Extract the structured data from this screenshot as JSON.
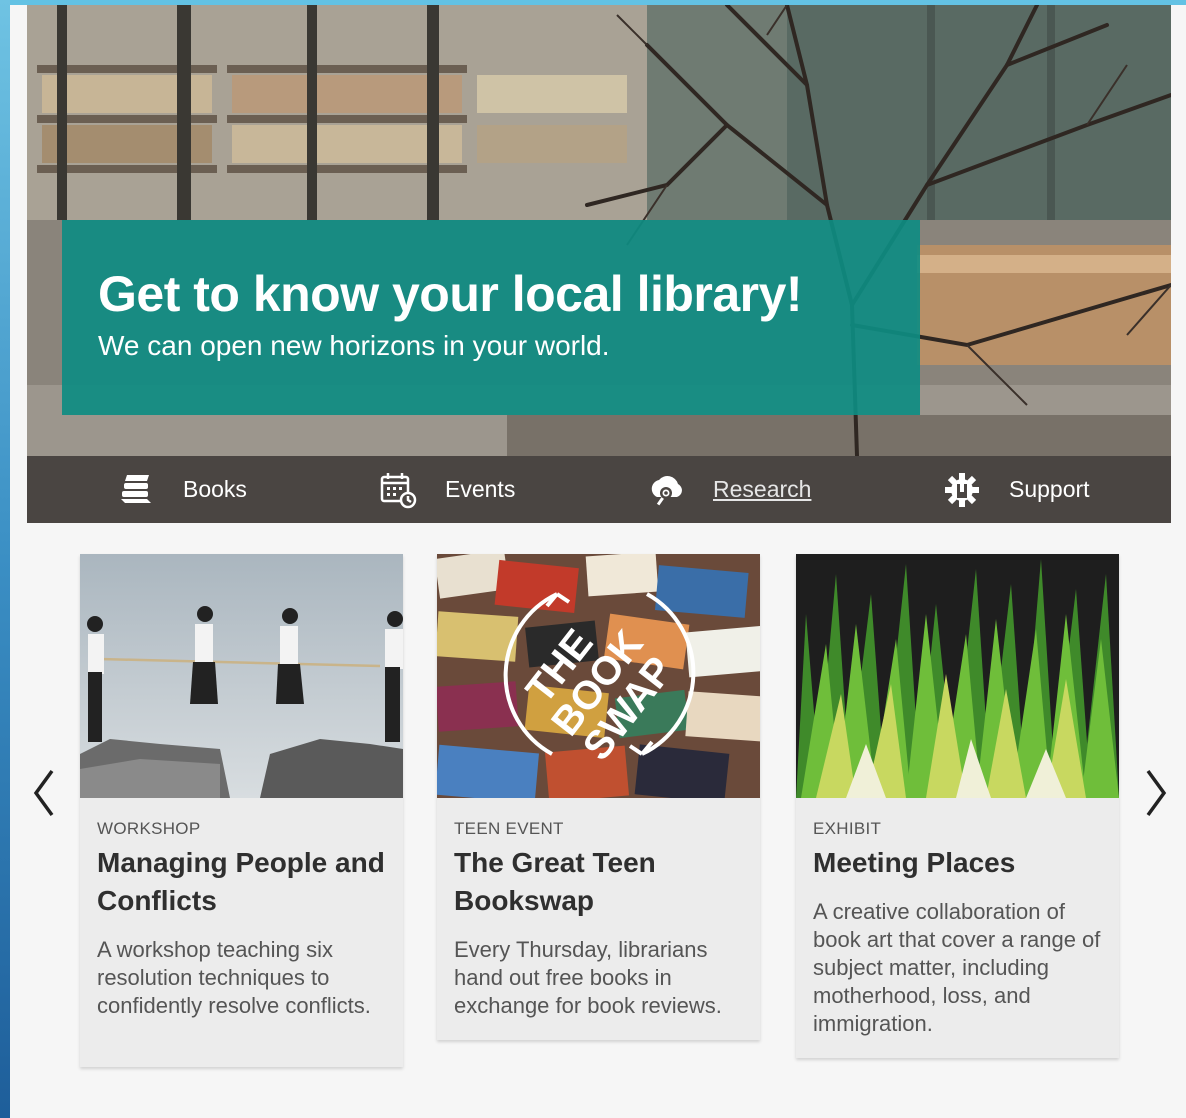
{
  "hero": {
    "title": "Get to know your local library!",
    "subtitle": "We can open new horizons in your world."
  },
  "nav": {
    "items": [
      {
        "label": "Books",
        "icon": "books-icon"
      },
      {
        "label": "Events",
        "icon": "calendar-icon"
      },
      {
        "label": "Research",
        "icon": "research-icon",
        "underlined": true
      },
      {
        "label": "Support",
        "icon": "support-gear-icon"
      }
    ]
  },
  "carousel": {
    "prev_icon": "chevron-left-icon",
    "next_icon": "chevron-right-icon",
    "cards": [
      {
        "category": "WORKSHOP",
        "title": "Managing People and Conflicts",
        "description": "A workshop teaching six resolution techniques to confidently resolve conflicts."
      },
      {
        "category": "TEEN EVENT",
        "title": "The Great Teen Bookswap",
        "description": "Every Thursday, librarians hand out free books in exchange for book reviews.",
        "image_text": [
          "THE",
          "BOOK",
          "SWAP"
        ]
      },
      {
        "category": "EXHIBIT",
        "title": "Meeting Places",
        "description": "A creative collaboration of book art that cover a range of subject matter, including motherhood, loss, and immigration."
      }
    ]
  },
  "colors": {
    "banner": "#0e8c82",
    "nav_bg": "#4a4542",
    "card_bg": "#ececec",
    "accent_blue": "#63c2e4"
  }
}
